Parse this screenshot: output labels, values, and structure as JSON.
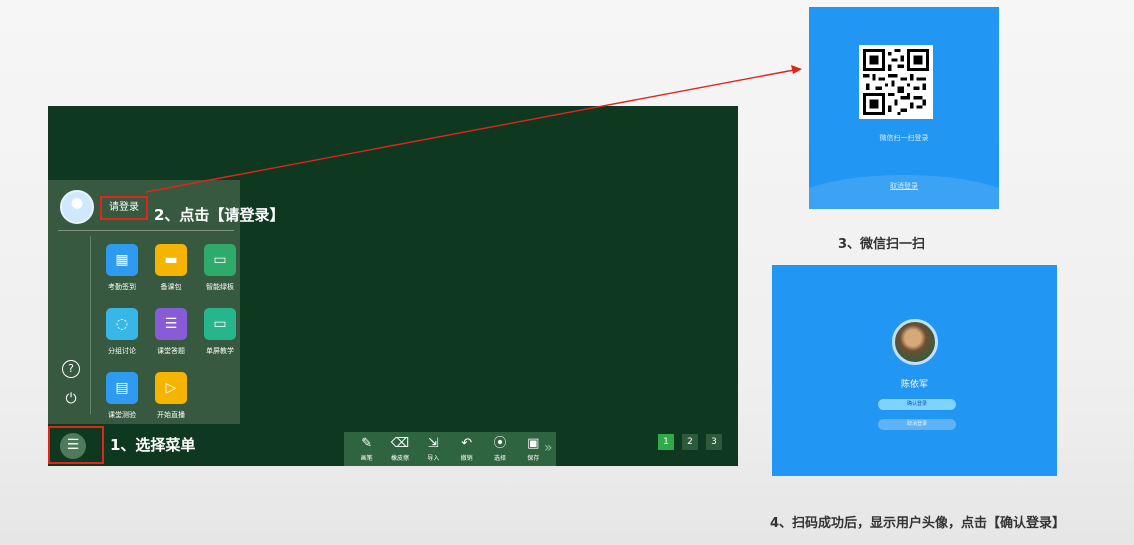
{
  "board": {
    "menu": {
      "login_label": "请登录",
      "apps": [
        {
          "label": "考勤签到",
          "icon": "calendar-icon",
          "color": "#2e9bf0"
        },
        {
          "label": "备课包",
          "icon": "folder-icon",
          "color": "#f5b400"
        },
        {
          "label": "智能绿板",
          "icon": "board-icon",
          "color": "#2eaa6a"
        },
        {
          "label": "分组讨论",
          "icon": "chat-icon",
          "color": "#38b6e8"
        },
        {
          "label": "课堂答题",
          "icon": "quiz-icon",
          "color": "#8a5bd6"
        },
        {
          "label": "单屏教学",
          "icon": "screen-icon",
          "color": "#27b58c"
        },
        {
          "label": "课堂测验",
          "icon": "test-icon",
          "color": "#2e9bf0"
        },
        {
          "label": "开始直播",
          "icon": "live-icon",
          "color": "#f5b400"
        }
      ],
      "help_icon": "?",
      "power_icon": "⏻"
    },
    "menu_button_icon": "☰",
    "toolbar": [
      {
        "label": "画笔",
        "icon": "pen-icon",
        "glyph": "✎"
      },
      {
        "label": "橡皮擦",
        "icon": "eraser-icon",
        "glyph": "⌫"
      },
      {
        "label": "导入",
        "icon": "import-icon",
        "glyph": "⇲"
      },
      {
        "label": "撤销",
        "icon": "undo-icon",
        "glyph": "↶"
      },
      {
        "label": "选择",
        "icon": "select-icon",
        "glyph": "⦿"
      },
      {
        "label": "保存",
        "icon": "save-icon",
        "glyph": "▣"
      }
    ],
    "more_glyph": "»",
    "pages": [
      "1",
      "2",
      "3"
    ]
  },
  "annotations": {
    "step1": "1、选择菜单",
    "step2": "2、点击【请登录】",
    "step3": "3、微信扫一扫",
    "step4": "4、扫码成功后，显示用户头像，点击【确认登录】"
  },
  "qr_panel": {
    "scan_text": "微信扫一扫登录",
    "cancel_text": "取消登录"
  },
  "confirm_panel": {
    "user_name": "陈依军",
    "confirm_label": "确认登录",
    "cancel_label": "取消登录"
  },
  "colors": {
    "board": "#0f3820",
    "accent_blue": "#2196f3",
    "highlight_red": "#e0251b"
  }
}
